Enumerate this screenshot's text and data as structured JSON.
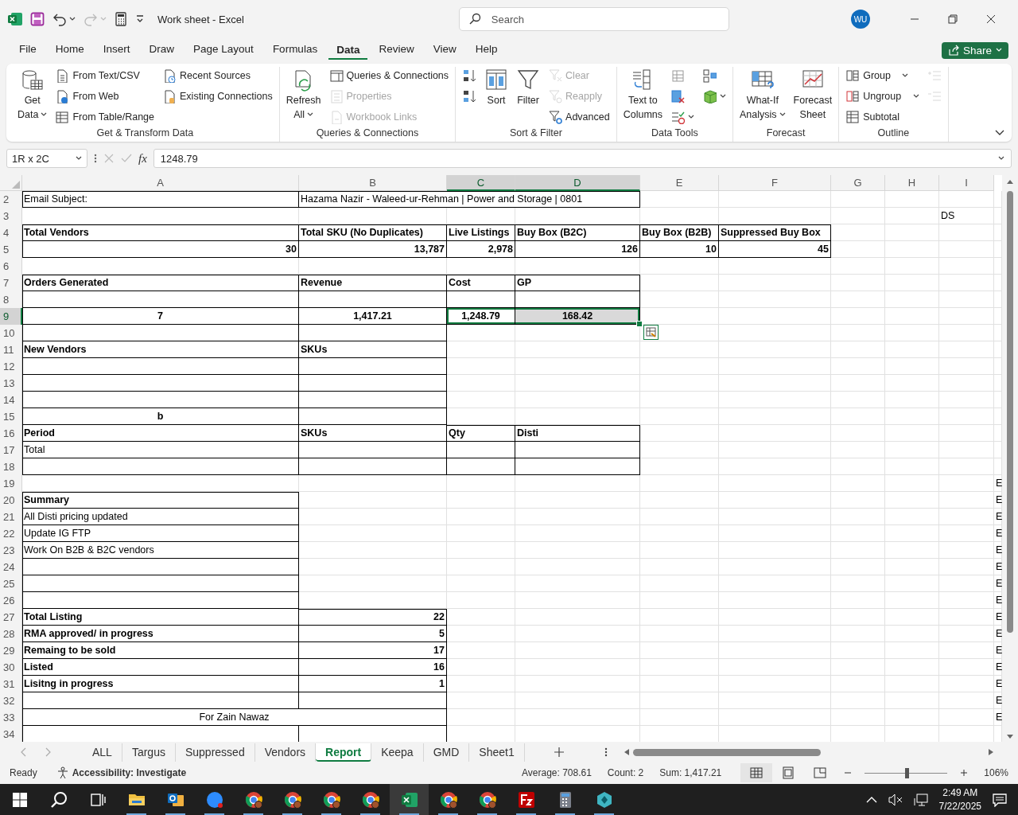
{
  "window": {
    "title": "Work sheet  -  Excel",
    "search": {
      "placeholder": "Search"
    },
    "avatar": "WU"
  },
  "menu_tabs": [
    {
      "label": "File",
      "selected": false
    },
    {
      "label": "Home",
      "selected": false
    },
    {
      "label": "Insert",
      "selected": false
    },
    {
      "label": "Draw",
      "selected": false
    },
    {
      "label": "Page Layout",
      "selected": false
    },
    {
      "label": "Formulas",
      "selected": false
    },
    {
      "label": "Data",
      "selected": true
    },
    {
      "label": "Review",
      "selected": false
    },
    {
      "label": "View",
      "selected": false
    },
    {
      "label": "Help",
      "selected": false
    }
  ],
  "share": "Share",
  "ribbon": {
    "groups": [
      {
        "label": "Get & Transform Data",
        "columns": [
          [
            {
              "kind": "large",
              "lines": [
                "Get",
                "Data"
              ],
              "menu": true,
              "disabled": false
            }
          ],
          [
            {
              "kind": "small",
              "label": "From Text/CSV",
              "disabled": false
            },
            {
              "kind": "small",
              "label": "From Web",
              "disabled": false
            },
            {
              "kind": "small",
              "label": "From Table/Range",
              "disabled": false
            }
          ],
          [
            {
              "kind": "small",
              "label": "Recent Sources",
              "disabled": false
            },
            {
              "kind": "small",
              "label": "Existing Connections",
              "disabled": false
            }
          ]
        ]
      },
      {
        "label": "Queries & Connections",
        "columns": [
          [
            {
              "kind": "large",
              "lines": [
                "Refresh",
                "All"
              ],
              "menu": true,
              "disabled": false
            }
          ],
          [
            {
              "kind": "small",
              "label": "Queries & Connections",
              "disabled": false
            },
            {
              "kind": "small",
              "label": "Properties",
              "disabled": true
            },
            {
              "kind": "small",
              "label": "Workbook Links",
              "disabled": true
            }
          ]
        ]
      },
      {
        "label": "Sort & Filter",
        "columns": [
          [
            {
              "kind": "icon",
              "disabled": false
            },
            {
              "kind": "icon",
              "disabled": false
            }
          ],
          [
            {
              "kind": "large",
              "lines": [
                "Sort"
              ],
              "disabled": false
            }
          ],
          [
            {
              "kind": "large",
              "lines": [
                "Filter"
              ],
              "disabled": false
            }
          ],
          [
            {
              "kind": "small",
              "label": "Clear",
              "disabled": true
            },
            {
              "kind": "small",
              "label": "Reapply",
              "disabled": true
            },
            {
              "kind": "small",
              "label": "Advanced",
              "disabled": false
            }
          ]
        ]
      },
      {
        "label": "Data Tools",
        "columns": [
          [
            {
              "kind": "large",
              "lines": [
                "Text to",
                "Columns"
              ],
              "disabled": false
            }
          ],
          [
            {
              "kind": "icon",
              "disabled": false
            },
            {
              "kind": "icon",
              "disabled": false
            },
            {
              "kind": "icon",
              "menu": true,
              "disabled": false
            }
          ],
          [
            {
              "kind": "icon",
              "disabled": false
            },
            {
              "kind": "icon",
              "menu": true,
              "disabled": false
            }
          ]
        ]
      },
      {
        "label": "Forecast",
        "columns": [
          [
            {
              "kind": "large",
              "lines": [
                "What-If",
                "Analysis"
              ],
              "menu": true,
              "disabled": false
            }
          ],
          [
            {
              "kind": "large",
              "lines": [
                "Forecast",
                "Sheet"
              ],
              "disabled": false
            }
          ]
        ]
      },
      {
        "label": "Outline",
        "columns": [
          [
            {
              "kind": "small",
              "label": "Group",
              "menu": true,
              "disabled": false
            },
            {
              "kind": "small",
              "label": "Ungroup",
              "menu": true,
              "disabled": false
            },
            {
              "kind": "small",
              "label": "Subtotal",
              "disabled": false
            }
          ],
          [
            {
              "kind": "icon",
              "disabled": true
            },
            {
              "kind": "icon",
              "disabled": true
            }
          ]
        ]
      }
    ]
  },
  "formula_bar": {
    "name_box": "1R x 2C",
    "fx": "fx",
    "formula": "1248.79"
  },
  "sheet": {
    "columns": [
      {
        "label": "A",
        "selected": false
      },
      {
        "label": "B",
        "selected": false
      },
      {
        "label": "C",
        "selected": true
      },
      {
        "label": "D",
        "selected": true
      },
      {
        "label": "E",
        "selected": false
      },
      {
        "label": "F",
        "selected": false
      },
      {
        "label": "G",
        "selected": false
      },
      {
        "label": "H",
        "selected": false
      },
      {
        "label": "I",
        "selected": false
      }
    ],
    "rows": [
      {
        "number": "2",
        "selected": false,
        "cells": [
          {
            "kind": "cell",
            "text": "Email Subject:",
            "border": true
          },
          {
            "kind": "cell",
            "text": "Hazama Nazir - Waleed-ur-Rehman | Power and Storage | 0801",
            "border": true
          },
          {
            "kind": "merged"
          },
          {
            "kind": "merged"
          }
        ]
      },
      {
        "number": "3",
        "selected": false,
        "cells": [
          {
            "kind": "cell",
            "border": false
          },
          {
            "kind": "cell",
            "border": false
          },
          {
            "kind": "cell",
            "border": false
          },
          {
            "kind": "cell",
            "border": false
          },
          {
            "kind": "cell",
            "border": false
          },
          {
            "kind": "cell",
            "border": false
          },
          {
            "kind": "cell",
            "border": false
          },
          {
            "kind": "cell",
            "border": false
          },
          {
            "kind": "cell",
            "text": "DS",
            "border": false
          }
        ]
      },
      {
        "number": "4",
        "selected": false,
        "cells": [
          {
            "kind": "cell",
            "text": "Total Vendors",
            "bold": true,
            "border": true
          },
          {
            "kind": "cell",
            "text": "Total SKU (No Duplicates)",
            "bold": true,
            "border": true
          },
          {
            "kind": "cell",
            "text": "Live Listings",
            "bold": true,
            "border": true
          },
          {
            "kind": "cell",
            "text": "Buy Box (B2C)",
            "bold": true,
            "border": true
          },
          {
            "kind": "cell",
            "text": "Buy Box (B2B)",
            "bold": true,
            "border": true
          },
          {
            "kind": "cell",
            "text": "Suppressed Buy Box",
            "bold": true,
            "border": true
          }
        ]
      },
      {
        "number": "5",
        "selected": false,
        "cells": [
          {
            "kind": "number",
            "text": "30",
            "bold": true,
            "border": true
          },
          {
            "kind": "number",
            "text": "13,787",
            "bold": true,
            "border": true
          },
          {
            "kind": "number",
            "text": "2,978",
            "bold": true,
            "border": true
          },
          {
            "kind": "number",
            "text": "126",
            "bold": true,
            "border": true
          },
          {
            "kind": "number",
            "text": "10",
            "bold": true,
            "border": true
          },
          {
            "kind": "number",
            "text": "45",
            "bold": true,
            "border": true
          }
        ]
      },
      {
        "number": "6",
        "selected": false
      },
      {
        "number": "7",
        "selected": false,
        "cells": [
          {
            "kind": "cell",
            "text": "Orders Generated",
            "bold": true,
            "border": true
          },
          {
            "kind": "cell",
            "text": "Revenue",
            "bold": true,
            "border": true
          },
          {
            "kind": "cell",
            "text": "Cost",
            "bold": true,
            "border": true
          },
          {
            "kind": "cell",
            "text": "GP",
            "bold": true,
            "border": true
          }
        ]
      },
      {
        "number": "8",
        "selected": false,
        "cells": [
          {
            "kind": "cell",
            "border": true
          },
          {
            "kind": "cell",
            "border": true
          },
          {
            "kind": "cell",
            "border": true
          },
          {
            "kind": "cell",
            "border": true
          }
        ]
      },
      {
        "number": "9",
        "selected": true,
        "cells": [
          {
            "kind": "centered",
            "text": "7",
            "bold": true,
            "border": true
          },
          {
            "kind": "centered",
            "text": "1,417.21",
            "bold": true,
            "border": true
          },
          {
            "kind": "centered",
            "text": "1,248.79",
            "bold": true,
            "border": true,
            "selected": true,
            "active": true
          },
          {
            "kind": "centered",
            "text": "168.42",
            "bold": true,
            "border": true,
            "selected": true
          }
        ]
      },
      {
        "number": "10",
        "selected": false,
        "cells": [
          {
            "kind": "cell",
            "border": true
          },
          {
            "kind": "cell",
            "border": true
          }
        ]
      },
      {
        "number": "11",
        "selected": false,
        "cells": [
          {
            "kind": "cell",
            "text": "New Vendors",
            "bold": true,
            "border": true
          },
          {
            "kind": "cell",
            "text": "SKUs",
            "bold": true,
            "border": true
          }
        ]
      },
      {
        "number": "12",
        "selected": false,
        "cells": [
          {
            "kind": "cell",
            "border": true
          },
          {
            "kind": "cell",
            "border": true
          }
        ]
      },
      {
        "number": "13",
        "selected": false,
        "cells": [
          {
            "kind": "cell",
            "border": true
          },
          {
            "kind": "cell",
            "border": true
          }
        ]
      },
      {
        "number": "14",
        "selected": false,
        "cells": [
          {
            "kind": "cell",
            "border": true
          },
          {
            "kind": "cell",
            "border": true
          }
        ]
      },
      {
        "number": "15",
        "selected": false,
        "cells": [
          {
            "kind": "centered",
            "text": "b",
            "bold": true,
            "border": true
          },
          {
            "kind": "cell",
            "border": true
          }
        ]
      },
      {
        "number": "16",
        "selected": false,
        "cells": [
          {
            "kind": "cell",
            "text": "Period",
            "bold": true,
            "border": true
          },
          {
            "kind": "cell",
            "text": "SKUs",
            "bold": true,
            "border": true
          },
          {
            "kind": "cell",
            "text": "Qty",
            "bold": true,
            "border": true
          },
          {
            "kind": "cell",
            "text": "Disti",
            "bold": true,
            "border": true
          }
        ]
      },
      {
        "number": "17",
        "selected": false,
        "cells": [
          {
            "kind": "cell",
            "text": "Total",
            "border": true
          },
          {
            "kind": "cell",
            "border": true
          },
          {
            "kind": "cell",
            "border": true
          },
          {
            "kind": "cell",
            "border": true
          }
        ]
      },
      {
        "number": "18",
        "selected": false,
        "cells": [
          {
            "kind": "cell",
            "border": true
          },
          {
            "kind": "cell",
            "border": true
          },
          {
            "kind": "cell",
            "border": true
          },
          {
            "kind": "cell",
            "border": true
          }
        ]
      },
      {
        "number": "19",
        "selected": false,
        "cells": [
          {
            "kind": "cell",
            "border": false
          },
          {
            "kind": "cell",
            "border": false
          },
          {
            "kind": "cell",
            "border": false
          },
          {
            "kind": "cell",
            "border": false
          },
          {
            "kind": "cell",
            "border": false
          },
          {
            "kind": "cell",
            "border": false
          },
          {
            "kind": "cell",
            "border": false
          },
          {
            "kind": "cell",
            "border": false
          },
          {
            "kind": "cell",
            "border": false
          },
          {
            "kind": "cell",
            "text": "E",
            "border": false
          }
        ]
      },
      {
        "number": "20",
        "selected": false,
        "cells": [
          {
            "kind": "cell",
            "text": "Summary",
            "bold": true,
            "border": true
          },
          {
            "kind": "cell",
            "border": false
          },
          {
            "kind": "cell",
            "border": false
          },
          {
            "kind": "cell",
            "border": false
          },
          {
            "kind": "cell",
            "border": false
          },
          {
            "kind": "cell",
            "border": false
          },
          {
            "kind": "cell",
            "border": false
          },
          {
            "kind": "cell",
            "border": false
          },
          {
            "kind": "cell",
            "border": false
          },
          {
            "kind": "cell",
            "text": "E",
            "border": false
          }
        ]
      },
      {
        "number": "21",
        "selected": false,
        "cells": [
          {
            "kind": "cell",
            "text": "All Disti pricing updated",
            "border": true
          },
          {
            "kind": "cell",
            "border": false
          },
          {
            "kind": "cell",
            "border": false
          },
          {
            "kind": "cell",
            "border": false
          },
          {
            "kind": "cell",
            "border": false
          },
          {
            "kind": "cell",
            "border": false
          },
          {
            "kind": "cell",
            "border": false
          },
          {
            "kind": "cell",
            "border": false
          },
          {
            "kind": "cell",
            "border": false
          },
          {
            "kind": "cell",
            "text": "E",
            "border": false
          }
        ]
      },
      {
        "number": "22",
        "selected": false,
        "cells": [
          {
            "kind": "cell",
            "text": "Update IG FTP",
            "border": true
          },
          {
            "kind": "cell",
            "border": false
          },
          {
            "kind": "cell",
            "border": false
          },
          {
            "kind": "cell",
            "border": false
          },
          {
            "kind": "cell",
            "border": false
          },
          {
            "kind": "cell",
            "border": false
          },
          {
            "kind": "cell",
            "border": false
          },
          {
            "kind": "cell",
            "border": false
          },
          {
            "kind": "cell",
            "border": false
          },
          {
            "kind": "cell",
            "text": "E",
            "border": false
          }
        ]
      },
      {
        "number": "23",
        "selected": false,
        "cells": [
          {
            "kind": "cell",
            "text": "Work On B2B & B2C vendors",
            "border": true
          },
          {
            "kind": "cell",
            "border": false
          },
          {
            "kind": "cell",
            "border": false
          },
          {
            "kind": "cell",
            "border": false
          },
          {
            "kind": "cell",
            "border": false
          },
          {
            "kind": "cell",
            "border": false
          },
          {
            "kind": "cell",
            "border": false
          },
          {
            "kind": "cell",
            "border": false
          },
          {
            "kind": "cell",
            "border": false
          },
          {
            "kind": "cell",
            "text": "E",
            "border": false
          }
        ]
      },
      {
        "number": "24",
        "selected": false,
        "cells": [
          {
            "kind": "cell",
            "border": true
          },
          {
            "kind": "cell",
            "border": false
          },
          {
            "kind": "cell",
            "border": false
          },
          {
            "kind": "cell",
            "border": false
          },
          {
            "kind": "cell",
            "border": false
          },
          {
            "kind": "cell",
            "border": false
          },
          {
            "kind": "cell",
            "border": false
          },
          {
            "kind": "cell",
            "border": false
          },
          {
            "kind": "cell",
            "border": false
          },
          {
            "kind": "cell",
            "text": "E",
            "border": false
          }
        ]
      },
      {
        "number": "25",
        "selected": false,
        "cells": [
          {
            "kind": "cell",
            "border": true
          },
          {
            "kind": "cell",
            "border": false
          },
          {
            "kind": "cell",
            "border": false
          },
          {
            "kind": "cell",
            "border": false
          },
          {
            "kind": "cell",
            "border": false
          },
          {
            "kind": "cell",
            "border": false
          },
          {
            "kind": "cell",
            "border": false
          },
          {
            "kind": "cell",
            "border": false
          },
          {
            "kind": "cell",
            "border": false
          },
          {
            "kind": "cell",
            "text": "E",
            "border": false
          }
        ]
      },
      {
        "number": "26",
        "selected": false,
        "cells": [
          {
            "kind": "cell",
            "border": true
          },
          {
            "kind": "cell",
            "border": false
          },
          {
            "kind": "cell",
            "border": false
          },
          {
            "kind": "cell",
            "border": false
          },
          {
            "kind": "cell",
            "border": false
          },
          {
            "kind": "cell",
            "border": false
          },
          {
            "kind": "cell",
            "border": false
          },
          {
            "kind": "cell",
            "border": false
          },
          {
            "kind": "cell",
            "border": false
          },
          {
            "kind": "cell",
            "text": "E",
            "border": false
          }
        ]
      },
      {
        "number": "27",
        "selected": false,
        "cells": [
          {
            "kind": "cell",
            "text": "Total Listing",
            "bold": true,
            "border": true
          },
          {
            "kind": "number",
            "text": "22",
            "bold": true,
            "border": true
          },
          {
            "kind": "cell",
            "border": false
          },
          {
            "kind": "cell",
            "border": false
          },
          {
            "kind": "cell",
            "border": false
          },
          {
            "kind": "cell",
            "border": false
          },
          {
            "kind": "cell",
            "border": false
          },
          {
            "kind": "cell",
            "border": false
          },
          {
            "kind": "cell",
            "border": false
          },
          {
            "kind": "cell",
            "text": "E",
            "border": false
          }
        ]
      },
      {
        "number": "28",
        "selected": false,
        "cells": [
          {
            "kind": "cell",
            "text": "RMA approved/ in progress",
            "bold": true,
            "border": true
          },
          {
            "kind": "number",
            "text": "5",
            "bold": true,
            "border": true
          },
          {
            "kind": "cell",
            "border": false
          },
          {
            "kind": "cell",
            "border": false
          },
          {
            "kind": "cell",
            "border": false
          },
          {
            "kind": "cell",
            "border": false
          },
          {
            "kind": "cell",
            "border": false
          },
          {
            "kind": "cell",
            "border": false
          },
          {
            "kind": "cell",
            "border": false
          },
          {
            "kind": "cell",
            "text": "E",
            "border": false
          }
        ]
      },
      {
        "number": "29",
        "selected": false,
        "cells": [
          {
            "kind": "cell",
            "text": "Remaing to be sold",
            "bold": true,
            "border": true
          },
          {
            "kind": "number",
            "text": "17",
            "bold": true,
            "border": true
          },
          {
            "kind": "cell",
            "border": false
          },
          {
            "kind": "cell",
            "border": false
          },
          {
            "kind": "cell",
            "border": false
          },
          {
            "kind": "cell",
            "border": false
          },
          {
            "kind": "cell",
            "border": false
          },
          {
            "kind": "cell",
            "border": false
          },
          {
            "kind": "cell",
            "border": false
          },
          {
            "kind": "cell",
            "text": "E",
            "border": false
          }
        ]
      },
      {
        "number": "30",
        "selected": false,
        "cells": [
          {
            "kind": "cell",
            "text": "Listed",
            "bold": true,
            "border": true
          },
          {
            "kind": "number",
            "text": "16",
            "bold": true,
            "border": true
          },
          {
            "kind": "cell",
            "border": false
          },
          {
            "kind": "cell",
            "border": false
          },
          {
            "kind": "cell",
            "border": false
          },
          {
            "kind": "cell",
            "border": false
          },
          {
            "kind": "cell",
            "border": false
          },
          {
            "kind": "cell",
            "border": false
          },
          {
            "kind": "cell",
            "border": false
          },
          {
            "kind": "cell",
            "text": "E",
            "border": false
          }
        ]
      },
      {
        "number": "31",
        "selected": false,
        "cells": [
          {
            "kind": "cell",
            "text": "Lisitng in progress",
            "bold": true,
            "border": true
          },
          {
            "kind": "number",
            "text": "1",
            "bold": true,
            "border": true
          },
          {
            "kind": "cell",
            "border": false
          },
          {
            "kind": "cell",
            "border": false
          },
          {
            "kind": "cell",
            "border": false
          },
          {
            "kind": "cell",
            "border": false
          },
          {
            "kind": "cell",
            "border": false
          },
          {
            "kind": "cell",
            "border": false
          },
          {
            "kind": "cell",
            "border": false
          },
          {
            "kind": "cell",
            "text": "E",
            "border": false
          }
        ]
      },
      {
        "number": "32",
        "selected": false,
        "cells": [
          {
            "kind": "cell",
            "border": true
          },
          {
            "kind": "cell",
            "border": true
          },
          {
            "kind": "cell",
            "border": false
          },
          {
            "kind": "cell",
            "border": false
          },
          {
            "kind": "cell",
            "border": false
          },
          {
            "kind": "cell",
            "border": false
          },
          {
            "kind": "cell",
            "border": false
          },
          {
            "kind": "cell",
            "border": false
          },
          {
            "kind": "cell",
            "border": false
          },
          {
            "kind": "cell",
            "text": "E",
            "border": false
          }
        ]
      },
      {
        "number": "33",
        "selected": false,
        "cells": [
          {
            "kind": "centered",
            "text": "For Zain Nawaz",
            "border": true
          },
          {
            "kind": "merged"
          },
          {
            "kind": "cell",
            "border": false
          },
          {
            "kind": "cell",
            "border": false
          },
          {
            "kind": "cell",
            "border": false
          },
          {
            "kind": "cell",
            "border": false
          },
          {
            "kind": "cell",
            "border": false
          },
          {
            "kind": "cell",
            "border": false
          },
          {
            "kind": "cell",
            "border": false
          },
          {
            "kind": "cell",
            "text": "E",
            "border": false
          }
        ]
      },
      {
        "number": "34",
        "selected": false,
        "cells": [
          {
            "kind": "cell",
            "border": true
          },
          {
            "kind": "cell",
            "border": true
          }
        ]
      }
    ]
  },
  "sheet_tabs": [
    {
      "label": "ALL",
      "selected": false
    },
    {
      "label": "Targus",
      "selected": false
    },
    {
      "label": "Suppressed",
      "selected": false
    },
    {
      "label": "Vendors",
      "selected": false
    },
    {
      "label": "Report",
      "selected": true
    },
    {
      "label": "Keepa",
      "selected": false
    },
    {
      "label": "GMD",
      "selected": false
    },
    {
      "label": "Sheet1",
      "selected": false
    }
  ],
  "status_bar": {
    "mode": "Ready",
    "accessibility": "Accessibility: Investigate",
    "average": "Average: 708.61",
    "count": "Count: 2",
    "sum": "Sum: 1,417.21",
    "views": [
      {
        "kind": "normal",
        "selected": true
      },
      {
        "kind": "page-layout",
        "selected": false
      },
      {
        "kind": "page-break",
        "selected": false
      }
    ],
    "zoom": {
      "level": 0.51,
      "reading": "106%"
    }
  },
  "taskbar": {
    "apps": [
      {
        "kind": "explorer",
        "active": false
      },
      {
        "kind": "mail",
        "active": false
      },
      {
        "kind": "video",
        "active": false
      },
      {
        "kind": "browser",
        "active": false
      },
      {
        "kind": "browser",
        "active": false
      },
      {
        "kind": "browser",
        "active": false
      },
      {
        "kind": "browser",
        "active": false
      },
      {
        "kind": "spreadsheet",
        "active": true
      },
      {
        "kind": "browser",
        "active": false
      },
      {
        "kind": "browser",
        "active": false
      },
      {
        "kind": "ftp",
        "active": false
      },
      {
        "kind": "calculator",
        "active": false
      },
      {
        "kind": "cube",
        "active": false
      }
    ],
    "time": "2:49 AM",
    "date": "7/22/2025"
  }
}
